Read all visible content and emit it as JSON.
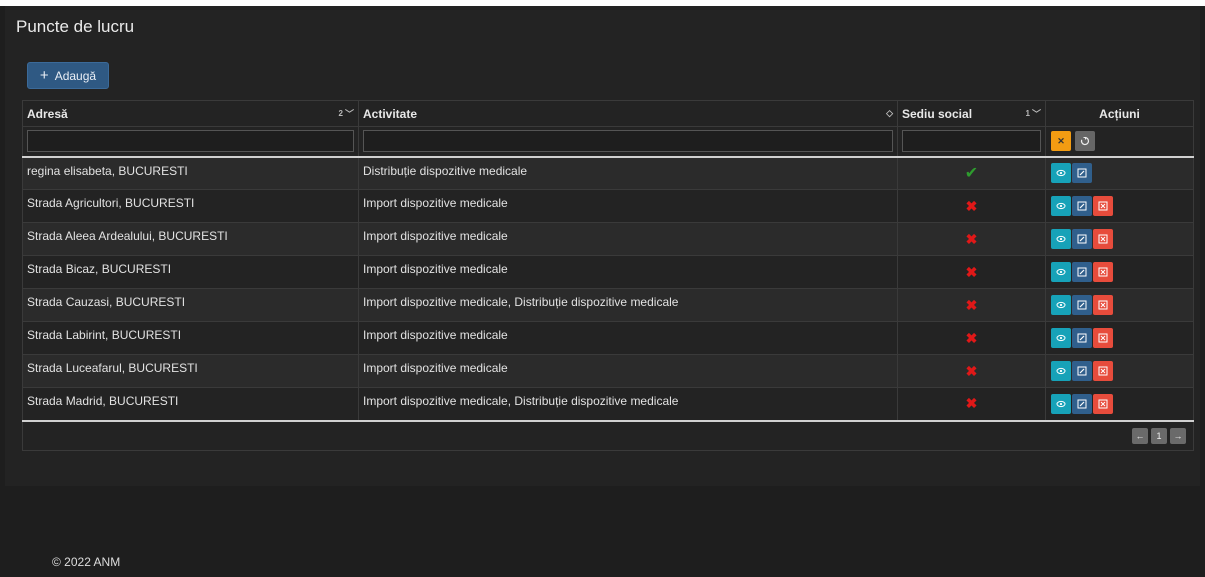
{
  "page": {
    "title": "Puncte de lucru",
    "footer": "© 2022 ANM"
  },
  "toolbar": {
    "add_label": "Adaugă"
  },
  "table": {
    "columns": [
      {
        "label": "Adresă",
        "sort_order": "2"
      },
      {
        "label": "Activitate",
        "sort_order": ""
      },
      {
        "label": "Sediu social",
        "sort_order": "1"
      },
      {
        "label": "Acțiuni",
        "sort_order": ""
      }
    ],
    "rows": [
      {
        "address": "regina elisabeta, BUCURESTI",
        "activity": "Distribuție dispozitive medicale",
        "seat": true
      },
      {
        "address": "Strada Agricultori, BUCURESTI",
        "activity": "Import dispozitive medicale",
        "seat": false
      },
      {
        "address": "Strada Aleea Ardealului, BUCURESTI",
        "activity": "Import dispozitive medicale",
        "seat": false
      },
      {
        "address": "Strada Bicaz, BUCURESTI",
        "activity": "Import dispozitive medicale",
        "seat": false
      },
      {
        "address": "Strada Cauzasi, BUCURESTI",
        "activity": "Import dispozitive medicale, Distribuție dispozitive medicale",
        "seat": false
      },
      {
        "address": "Strada Labirint, BUCURESTI",
        "activity": "Import dispozitive medicale",
        "seat": false
      },
      {
        "address": "Strada Luceafarul, BUCURESTI",
        "activity": "Import dispozitive medicale",
        "seat": false
      },
      {
        "address": "Strada Madrid, BUCURESTI",
        "activity": "Import dispozitive medicale, Distribuție dispozitive medicale",
        "seat": false
      }
    ]
  },
  "pagination": {
    "prev": "←",
    "current": "1",
    "next": "→"
  },
  "icons": {
    "seat_yes": "check-icon",
    "seat_no": "cross-icon"
  },
  "colors": {
    "view": "#17a2b8",
    "edit": "#305f8c",
    "delete": "#e74c3c",
    "clear_filter": "#f39c12",
    "check": "#2e9c2e",
    "cross": "#e01818"
  }
}
